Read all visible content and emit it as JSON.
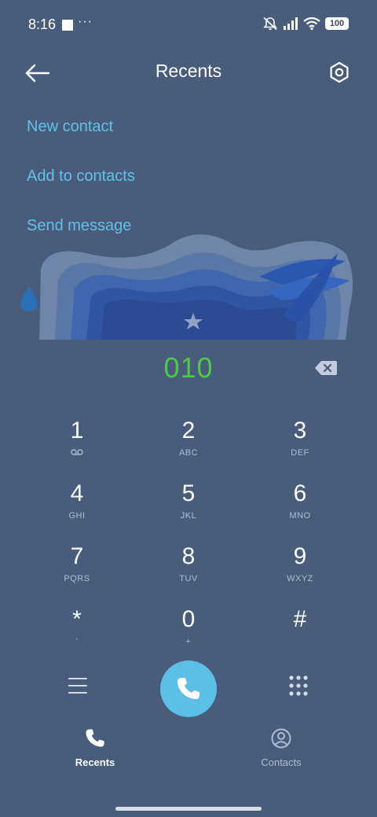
{
  "status_bar": {
    "time": "8:16",
    "more_indicator": "···",
    "battery": "100",
    "icons": [
      "mute-icon",
      "signal-icon",
      "wifi-icon",
      "battery-icon"
    ]
  },
  "header": {
    "title": "Recents",
    "back_icon": "arrow-left-icon",
    "settings_icon": "settings-icon"
  },
  "actions": {
    "new_contact": "New contact",
    "add_to_contacts": "Add to contacts",
    "send_message": "Send message"
  },
  "dialer": {
    "number": "010",
    "backspace_icon": "backspace-icon"
  },
  "keypad": {
    "keys": [
      {
        "digit": "1",
        "letters": "⌨"
      },
      {
        "digit": "2",
        "letters": "ABC"
      },
      {
        "digit": "3",
        "letters": "DEF"
      },
      {
        "digit": "4",
        "letters": "GHI"
      },
      {
        "digit": "5",
        "letters": "JKL"
      },
      {
        "digit": "6",
        "letters": "MNO"
      },
      {
        "digit": "7",
        "letters": "PQRS"
      },
      {
        "digit": "8",
        "letters": "TUV"
      },
      {
        "digit": "9",
        "letters": "WXYZ"
      },
      {
        "digit": "*",
        "letters": "'"
      },
      {
        "digit": "0",
        "letters": "+"
      },
      {
        "digit": "#",
        "letters": ""
      }
    ]
  },
  "bottom_actions": {
    "menu_icon": "menu-icon",
    "call_icon": "phone-icon",
    "keypad_icon": "dialpad-icon"
  },
  "nav": {
    "recents": "Recents",
    "contacts": "Contacts"
  },
  "colors": {
    "background": "#4a5c7c",
    "accent": "#5ec0e8",
    "dialed_number": "#4cc94a",
    "call_button": "#5cbfe6"
  }
}
